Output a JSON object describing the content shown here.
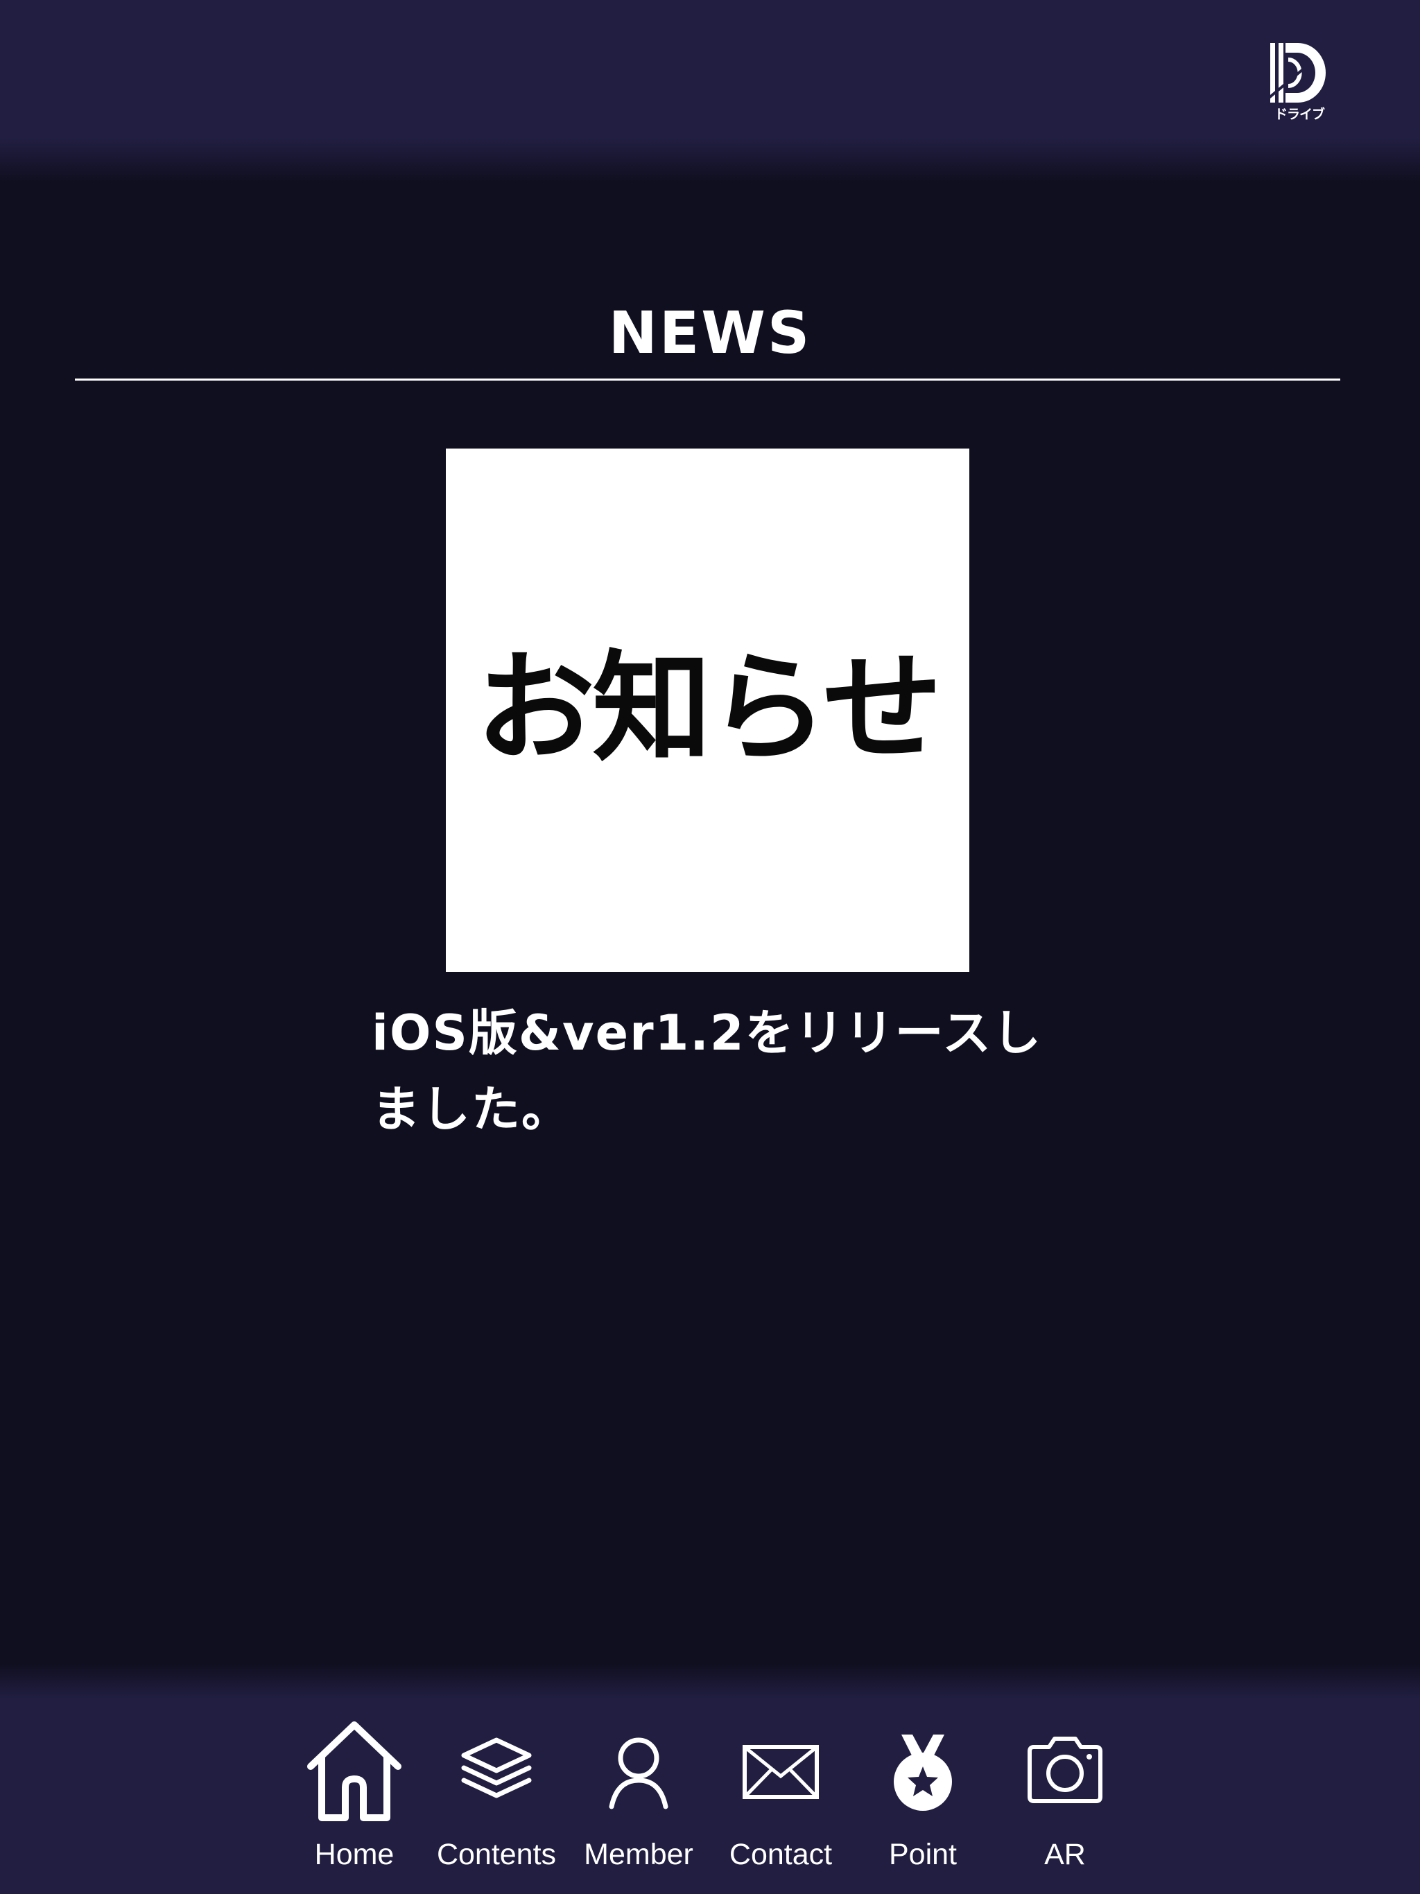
{
  "header": {
    "logo_text": "ドライブ"
  },
  "section": {
    "title": "NEWS"
  },
  "news": {
    "image_text": "お知らせ",
    "item_text": "iOS版&ver1.2をリリースしました。"
  },
  "tabbar": {
    "items": [
      {
        "label": "Home",
        "icon": "home-icon"
      },
      {
        "label": "Contents",
        "icon": "layers-icon"
      },
      {
        "label": "Member",
        "icon": "person-icon"
      },
      {
        "label": "Contact",
        "icon": "mail-icon"
      },
      {
        "label": "Point",
        "icon": "medal-icon"
      },
      {
        "label": "AR",
        "icon": "camera-icon"
      }
    ]
  },
  "colors": {
    "header_bg": "#211e41",
    "page_bg": "#100f20",
    "text": "#ffffff"
  }
}
